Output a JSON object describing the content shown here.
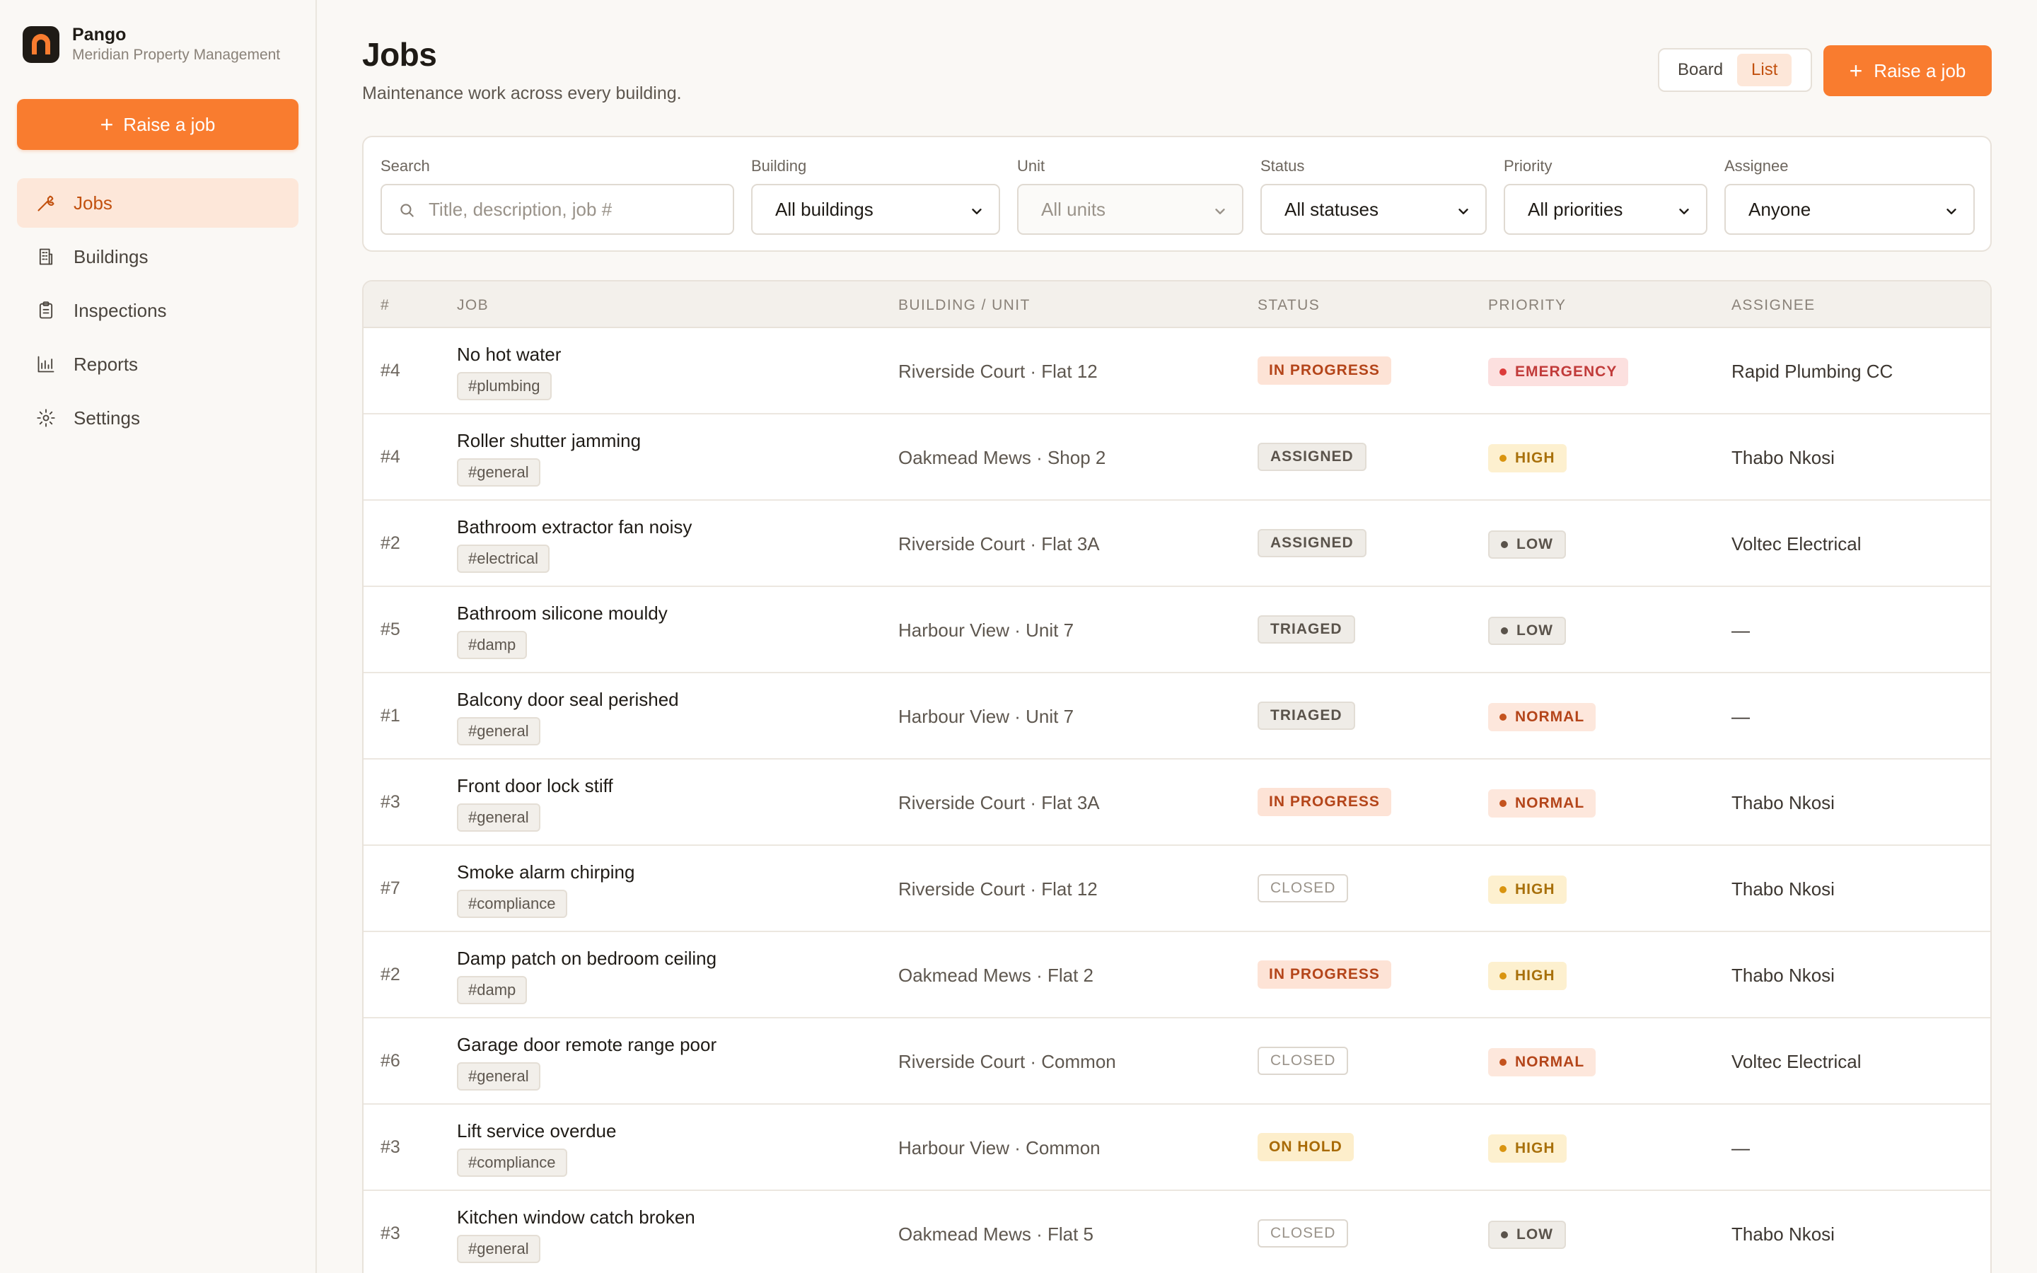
{
  "brand": {
    "name": "Pango",
    "org": "Meridian Property Management"
  },
  "sidebar": {
    "raise_label": "Raise a job",
    "items": [
      {
        "label": "Jobs",
        "icon": "wrench-icon",
        "active": true
      },
      {
        "label": "Buildings",
        "icon": "building-icon",
        "active": false
      },
      {
        "label": "Inspections",
        "icon": "clipboard-icon",
        "active": false
      },
      {
        "label": "Reports",
        "icon": "bar-chart-icon",
        "active": false
      },
      {
        "label": "Settings",
        "icon": "gear-icon",
        "active": false
      }
    ]
  },
  "header": {
    "title": "Jobs",
    "subtitle": "Maintenance work across every building.",
    "view_board": "Board",
    "view_list": "List",
    "active_view": "List",
    "raise_label": "Raise a job"
  },
  "filters": {
    "search_label": "Search",
    "search_placeholder": "Title, description, job #",
    "building_label": "Building",
    "building_value": "All buildings",
    "unit_label": "Unit",
    "unit_value": "All units",
    "status_label": "Status",
    "status_value": "All statuses",
    "priority_label": "Priority",
    "priority_value": "All priorities",
    "assignee_label": "Assignee",
    "assignee_value": "Anyone"
  },
  "table": {
    "headers": {
      "num": "#",
      "job": "JOB",
      "building": "BUILDING / UNIT",
      "status": "STATUS",
      "priority": "PRIORITY",
      "assignee": "ASSIGNEE"
    },
    "rows": [
      {
        "num": "#4",
        "title": "No hot water",
        "tag": "#plumbing",
        "building": "Riverside Court · Flat 12",
        "status": "IN PROGRESS",
        "status_key": "inprogress",
        "priority": "EMERGENCY",
        "priority_key": "emergency",
        "assignee": "Rapid Plumbing CC"
      },
      {
        "num": "#4",
        "title": "Roller shutter jamming",
        "tag": "#general",
        "building": "Oakmead Mews · Shop 2",
        "status": "ASSIGNED",
        "status_key": "assigned",
        "priority": "HIGH",
        "priority_key": "high",
        "assignee": "Thabo Nkosi"
      },
      {
        "num": "#2",
        "title": "Bathroom extractor fan noisy",
        "tag": "#electrical",
        "building": "Riverside Court · Flat 3A",
        "status": "ASSIGNED",
        "status_key": "assigned",
        "priority": "LOW",
        "priority_key": "low",
        "assignee": "Voltec Electrical"
      },
      {
        "num": "#5",
        "title": "Bathroom silicone mouldy",
        "tag": "#damp",
        "building": "Harbour View · Unit 7",
        "status": "TRIAGED",
        "status_key": "triaged",
        "priority": "LOW",
        "priority_key": "low",
        "assignee": "—"
      },
      {
        "num": "#1",
        "title": "Balcony door seal perished",
        "tag": "#general",
        "building": "Harbour View · Unit 7",
        "status": "TRIAGED",
        "status_key": "triaged",
        "priority": "NORMAL",
        "priority_key": "normal",
        "assignee": "—"
      },
      {
        "num": "#3",
        "title": "Front door lock stiff",
        "tag": "#general",
        "building": "Riverside Court · Flat 3A",
        "status": "IN PROGRESS",
        "status_key": "inprogress",
        "priority": "NORMAL",
        "priority_key": "normal",
        "assignee": "Thabo Nkosi"
      },
      {
        "num": "#7",
        "title": "Smoke alarm chirping",
        "tag": "#compliance",
        "building": "Riverside Court · Flat 12",
        "status": "CLOSED",
        "status_key": "closed",
        "priority": "HIGH",
        "priority_key": "high",
        "assignee": "Thabo Nkosi"
      },
      {
        "num": "#2",
        "title": "Damp patch on bedroom ceiling",
        "tag": "#damp",
        "building": "Oakmead Mews · Flat 2",
        "status": "IN PROGRESS",
        "status_key": "inprogress",
        "priority": "HIGH",
        "priority_key": "high",
        "assignee": "Thabo Nkosi"
      },
      {
        "num": "#6",
        "title": "Garage door remote range poor",
        "tag": "#general",
        "building": "Riverside Court · Common",
        "status": "CLOSED",
        "status_key": "closed",
        "priority": "NORMAL",
        "priority_key": "normal",
        "assignee": "Voltec Electrical"
      },
      {
        "num": "#3",
        "title": "Lift service overdue",
        "tag": "#compliance",
        "building": "Harbour View · Common",
        "status": "ON HOLD",
        "status_key": "onhold",
        "priority": "HIGH",
        "priority_key": "high",
        "assignee": "—"
      },
      {
        "num": "#3",
        "title": "Kitchen window catch broken",
        "tag": "#general",
        "building": "Oakmead Mews · Flat 5",
        "status": "CLOSED",
        "status_key": "closed",
        "priority": "LOW",
        "priority_key": "low",
        "assignee": "Thabo Nkosi"
      }
    ]
  },
  "colors": {
    "accent": "#f97c2f",
    "accent_soft": "#fde7d9",
    "background": "#faf8f5"
  }
}
